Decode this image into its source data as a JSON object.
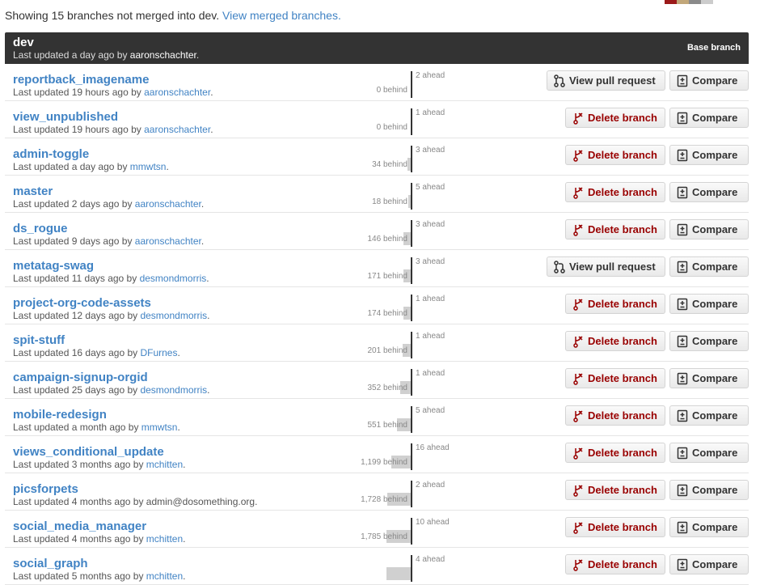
{
  "header": {
    "summary_text": "Showing 15 branches not merged into dev.",
    "merged_link": "View merged branches."
  },
  "colors": {
    "link": "#4183c4",
    "delete": "#990000",
    "header_bg": "#333333",
    "swatches": [
      "#9b1a1a",
      "#c2a77a",
      "#8a8a8a",
      "#cccccc"
    ]
  },
  "base_branch": {
    "name": "dev",
    "updated": "Last updated a day ago by ",
    "author": "aaronschachter",
    "period": ".",
    "label": "Base branch"
  },
  "labels": {
    "compare": "Compare",
    "delete": "Delete branch",
    "pull_request": "View pull request"
  },
  "icons": {
    "compare": "compare-icon",
    "delete": "branch-delete-icon",
    "pull_request": "pull-request-icon"
  },
  "branches": [
    {
      "name": "reportback_imagename",
      "updated": "Last updated 19 hours ago by ",
      "author": "aaronschachter",
      "behind": "0 behind",
      "ahead": "2 ahead",
      "behind_count": 0,
      "ahead_count": 2,
      "action": "pr"
    },
    {
      "name": "view_unpublished",
      "updated": "Last updated 19 hours ago by ",
      "author": "aaronschachter",
      "behind": "0 behind",
      "ahead": "1 ahead",
      "behind_count": 0,
      "ahead_count": 1,
      "action": "delete"
    },
    {
      "name": "admin-toggle",
      "updated": "Last updated a day ago by ",
      "author": "mmwtsn",
      "behind": "34 behind",
      "ahead": "3 ahead",
      "behind_count": 34,
      "ahead_count": 3,
      "action": "delete"
    },
    {
      "name": "master",
      "updated": "Last updated 2 days ago by ",
      "author": "aaronschachter",
      "behind": "18 behind",
      "ahead": "5 ahead",
      "behind_count": 18,
      "ahead_count": 5,
      "action": "delete"
    },
    {
      "name": "ds_rogue",
      "updated": "Last updated 9 days ago by ",
      "author": "aaronschachter",
      "behind": "146 behind",
      "ahead": "3 ahead",
      "behind_count": 146,
      "ahead_count": 3,
      "action": "delete"
    },
    {
      "name": "metatag-swag",
      "updated": "Last updated 11 days ago by ",
      "author": "desmondmorris",
      "behind": "171 behind",
      "ahead": "3 ahead",
      "behind_count": 171,
      "ahead_count": 3,
      "action": "pr"
    },
    {
      "name": "project-org-code-assets",
      "updated": "Last updated 12 days ago by ",
      "author": "desmondmorris",
      "behind": "174 behind",
      "ahead": "1 ahead",
      "behind_count": 174,
      "ahead_count": 1,
      "action": "delete"
    },
    {
      "name": "spit-stuff",
      "updated": "Last updated 16 days ago by ",
      "author": "DFurnes",
      "behind": "201 behind",
      "ahead": "1 ahead",
      "behind_count": 201,
      "ahead_count": 1,
      "action": "delete"
    },
    {
      "name": "campaign-signup-orgid",
      "updated": "Last updated 25 days ago by ",
      "author": "desmondmorris",
      "behind": "352 behind",
      "ahead": "1 ahead",
      "behind_count": 352,
      "ahead_count": 1,
      "action": "delete"
    },
    {
      "name": "mobile-redesign",
      "updated": "Last updated a month ago by ",
      "author": "mmwtsn",
      "behind": "551 behind",
      "ahead": "5 ahead",
      "behind_count": 551,
      "ahead_count": 5,
      "action": "delete"
    },
    {
      "name": "views_conditional_update",
      "updated": "Last updated 3 months ago by ",
      "author": "mchitten",
      "behind": "1,199 behind",
      "ahead": "16 ahead",
      "behind_count": 1199,
      "ahead_count": 16,
      "action": "delete"
    },
    {
      "name": "picsforpets",
      "updated": "Last updated 4 months ago by ",
      "author": "admin@dosomething.org",
      "plain_author": true,
      "behind": "1,728 behind",
      "ahead": "2 ahead",
      "behind_count": 1728,
      "ahead_count": 2,
      "action": "delete"
    },
    {
      "name": "social_media_manager",
      "updated": "Last updated 4 months ago by ",
      "author": "mchitten",
      "behind": "1,785 behind",
      "ahead": "10 ahead",
      "behind_count": 1785,
      "ahead_count": 10,
      "action": "delete"
    },
    {
      "name": "social_graph",
      "updated": "Last updated 5 months ago by ",
      "author": "mchitten",
      "behind": "",
      "ahead": "4 ahead",
      "behind_count": 1800,
      "ahead_count": 4,
      "action": "delete"
    }
  ]
}
